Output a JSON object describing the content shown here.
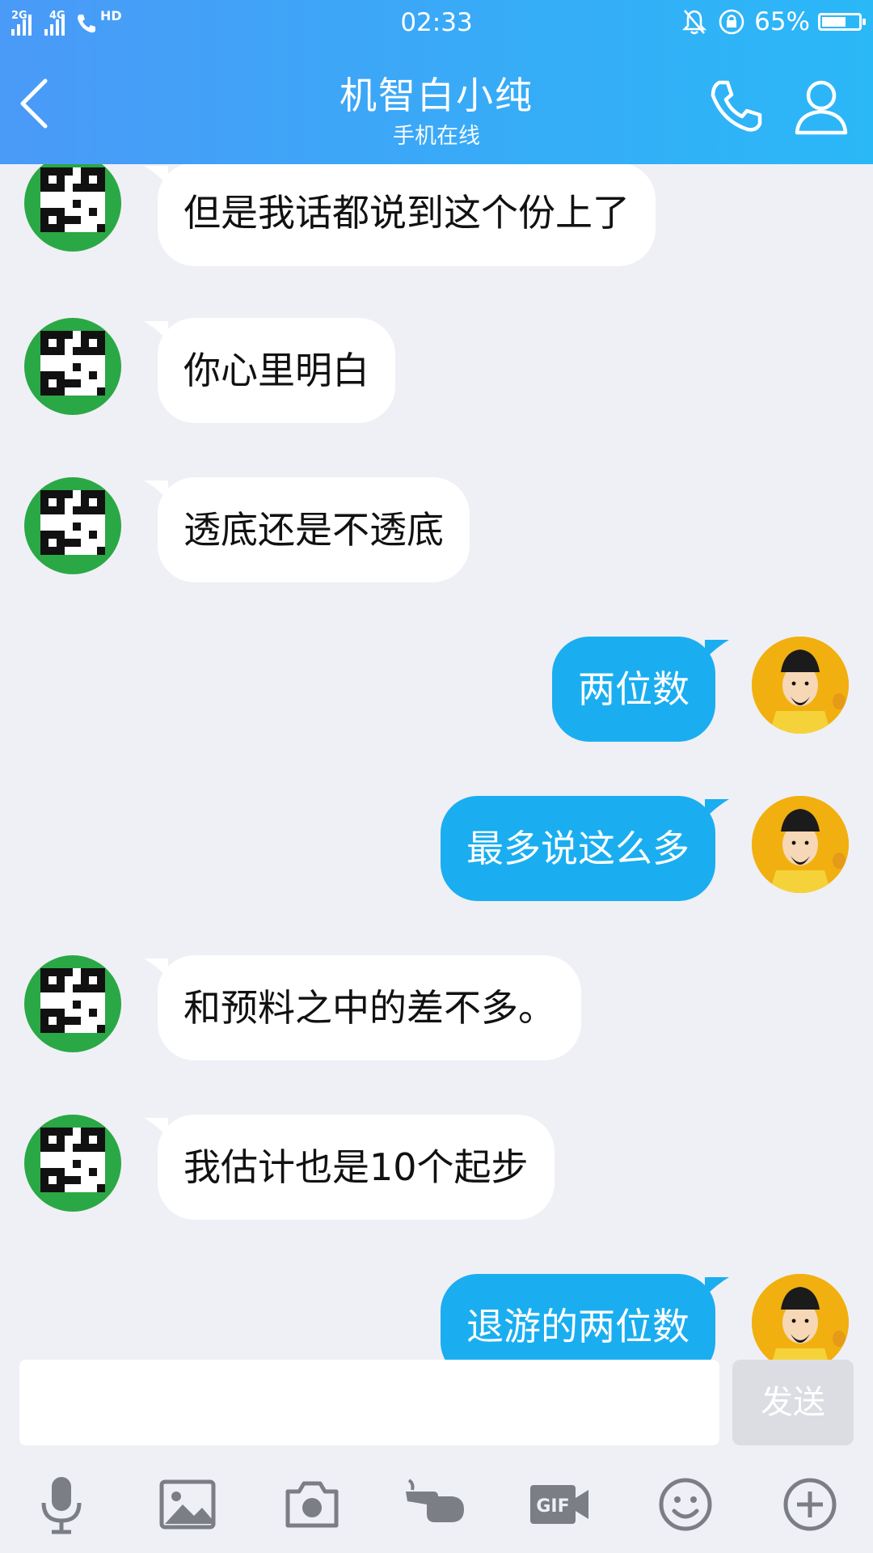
{
  "status_bar": {
    "network_1": "2G",
    "network_2": "4G",
    "hd": "HD",
    "time": "02:33",
    "battery_percent": "65%",
    "battery_level": 0.65
  },
  "header": {
    "title": "机智白小纯",
    "subtitle": "手机在线",
    "background_start": "#4a9af7",
    "background_end": "#2ab8f7"
  },
  "messages": [
    {
      "direction": "in",
      "text": "但是我话都说到这个份上了"
    },
    {
      "direction": "in",
      "text": "你心里明白"
    },
    {
      "direction": "in",
      "text": "透底还是不透底"
    },
    {
      "direction": "out",
      "text": "两位数"
    },
    {
      "direction": "out",
      "text": "最多说这么多"
    },
    {
      "direction": "in",
      "text": "和预料之中的差不多。"
    },
    {
      "direction": "in",
      "text": "我估计也是10个起步"
    },
    {
      "direction": "out",
      "text": "退游的两位数"
    }
  ],
  "colors": {
    "outgoing_bubble": "#1aaef0",
    "incoming_bubble": "#ffffff",
    "chat_background": "#eff0f5"
  },
  "input": {
    "value": "",
    "placeholder": "",
    "send_label": "发送"
  },
  "toolbar_icons": [
    "microphone-icon",
    "image-icon",
    "camera-icon",
    "poke-hand-icon",
    "gif-icon",
    "emoji-icon",
    "plus-icon"
  ]
}
